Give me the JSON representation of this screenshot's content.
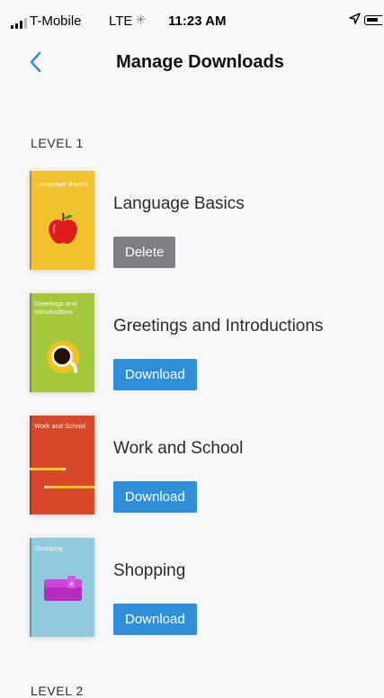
{
  "status_bar": {
    "carrier": "T-Mobile",
    "network": "LTE",
    "spinner": "✳",
    "time": "11:23 AM"
  },
  "nav": {
    "back_icon": "chevron-left-icon",
    "title": "Manage Downloads"
  },
  "colors": {
    "accent": "#2f8fd8",
    "delete": "#7d7f82"
  },
  "levels": [
    {
      "label": "LEVEL 1",
      "courses": [
        {
          "cover_text": "Language Basics",
          "cover_color": "#f2c12e",
          "title": "Language Basics",
          "action": "Delete",
          "art": "apple"
        },
        {
          "cover_text": "Greetings and Introductions",
          "cover_color": "#a6c83c",
          "title": "Greetings and Introductions",
          "action": "Download",
          "art": "coffee-cup"
        },
        {
          "cover_text": "Work and School",
          "cover_color": "#d9472b",
          "title": "Work and School",
          "action": "Download",
          "art": "pencils"
        },
        {
          "cover_text": "Shopping",
          "cover_color": "#8fcbdc",
          "title": "Shopping",
          "action": "Download",
          "art": "wallet"
        }
      ]
    },
    {
      "label": "LEVEL 2",
      "courses": []
    }
  ]
}
